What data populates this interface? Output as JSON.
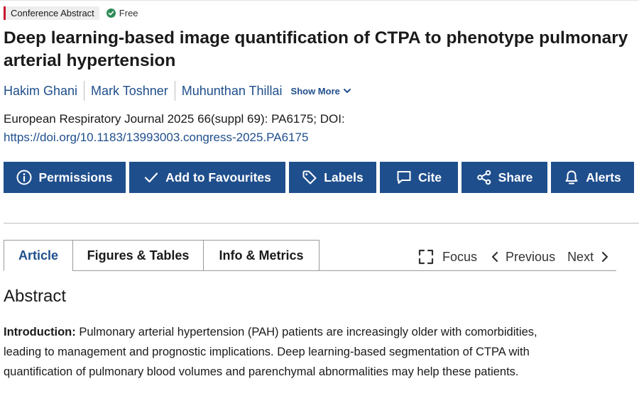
{
  "badges": {
    "type": "Conference Abstract",
    "access": "Free"
  },
  "article": {
    "title": "Deep learning-based image quantification of CTPA to phenotype pulmonary arterial hypertension",
    "authors": [
      "Hakim Ghani",
      "Mark Toshner",
      "Muhunthan Thillai"
    ],
    "show_more": "Show More",
    "citation": "European Respiratory Journal 2025 66(suppl 69): PA6175; DOI:",
    "doi": "https://doi.org/10.1183/13993003.congress-2025.PA6175"
  },
  "actions": [
    {
      "label": "Permissions",
      "icon": "info-icon"
    },
    {
      "label": "Add to Favourites",
      "icon": "check-icon"
    },
    {
      "label": "Labels",
      "icon": "tag-icon"
    },
    {
      "label": "Cite",
      "icon": "speech-bubble-icon"
    },
    {
      "label": "Share",
      "icon": "share-icon"
    },
    {
      "label": "Alerts",
      "icon": "bell-icon"
    }
  ],
  "tabs": [
    "Article",
    "Figures & Tables",
    "Info & Metrics"
  ],
  "active_tab": "Article",
  "tools": {
    "focus": "Focus",
    "previous": "Previous",
    "next": "Next"
  },
  "abstract": {
    "heading": "Abstract",
    "intro_label": "Introduction:",
    "intro_text": " Pulmonary arterial hypertension (PAH) patients are increasingly older with comorbidities, leading to management and prognostic implications. Deep learning-based segmentation of CTPA with quantification of pulmonary blood volumes and parenchymal abnormalities may help these patients."
  },
  "colors": {
    "primary": "#1f4e8c",
    "badge_accent": "#c8102e",
    "free_green": "#2e8b57"
  }
}
